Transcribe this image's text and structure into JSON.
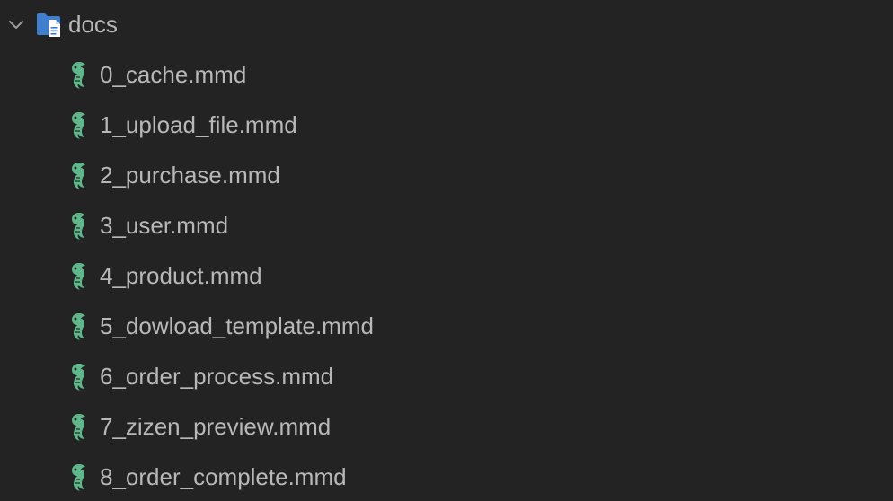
{
  "folder": {
    "name": "docs",
    "expanded": true,
    "chevron_icon": "chevron-down-icon",
    "icon": "folder-docs-icon",
    "icon_color": "#4a8fe0"
  },
  "files": [
    {
      "name": "0_cache.mmd",
      "icon": "mermaid-icon"
    },
    {
      "name": "1_upload_file.mmd",
      "icon": "mermaid-icon"
    },
    {
      "name": "2_purchase.mmd",
      "icon": "mermaid-icon"
    },
    {
      "name": "3_user.mmd",
      "icon": "mermaid-icon"
    },
    {
      "name": "4_product.mmd",
      "icon": "mermaid-icon"
    },
    {
      "name": "5_dowload_template.mmd",
      "icon": "mermaid-icon"
    },
    {
      "name": "6_order_process.mmd",
      "icon": "mermaid-icon"
    },
    {
      "name": "7_zizen_preview.mmd",
      "icon": "mermaid-icon"
    },
    {
      "name": "8_order_complete.mmd",
      "icon": "mermaid-icon"
    }
  ],
  "colors": {
    "background": "#232323",
    "text": "#b8b8b8",
    "mermaid_icon": "#5fb88a"
  }
}
